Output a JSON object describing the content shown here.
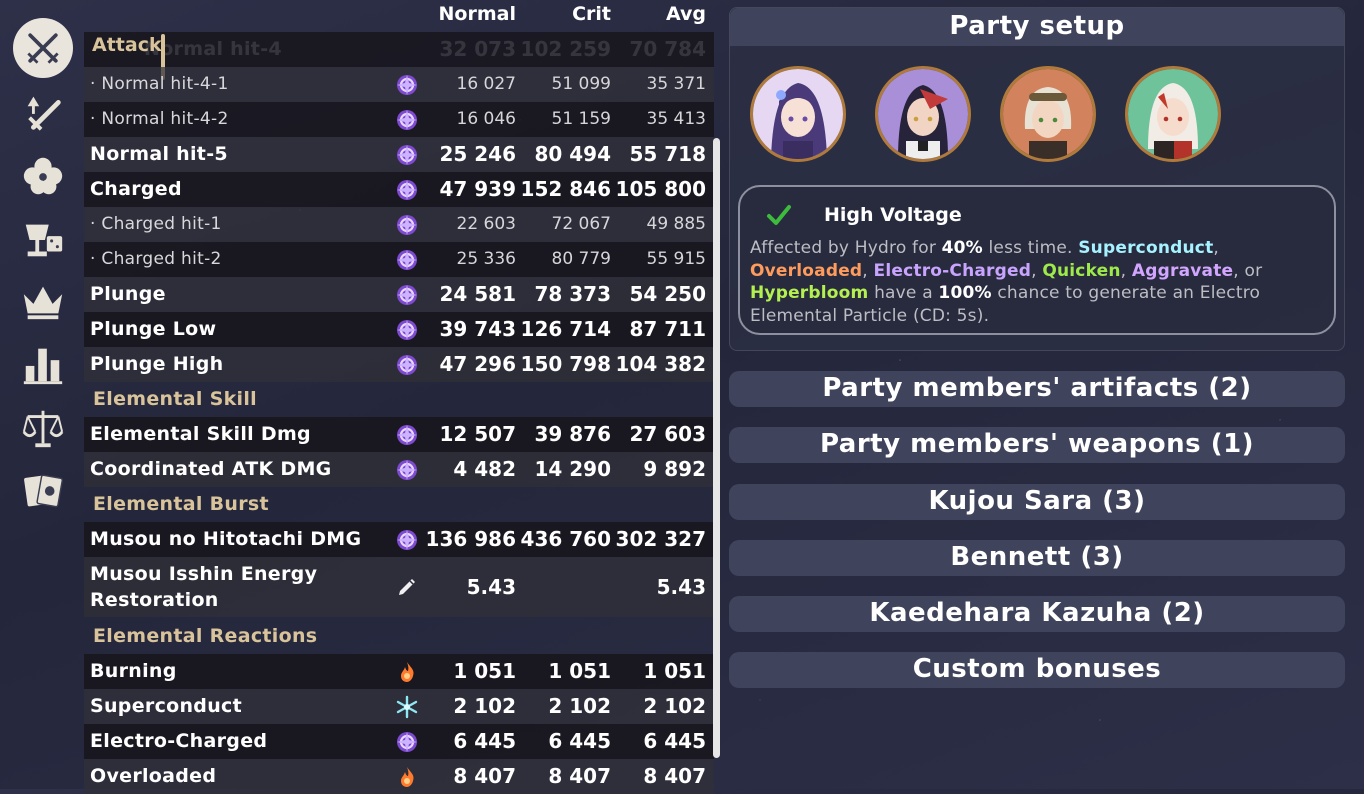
{
  "sidebar": {
    "items": [
      {
        "icon": "crossed-swords-icon"
      },
      {
        "icon": "sword-upgrade-icon"
      },
      {
        "icon": "flower-artifact-icon"
      },
      {
        "icon": "goblet-dice-icon"
      },
      {
        "icon": "crown-icon"
      },
      {
        "icon": "bar-chart-icon"
      },
      {
        "icon": "scales-icon"
      },
      {
        "icon": "cards-icon"
      }
    ]
  },
  "table": {
    "headers": {
      "normal": "Normal",
      "crit": "Crit",
      "avg": "Avg"
    },
    "attack_header": "Attack",
    "hidden_row": {
      "name": "Normal hit-4",
      "normal": "32 073",
      "crit": "102 259",
      "avg": "70 784"
    },
    "rows": [
      {
        "name": "· Normal hit-4-1",
        "icon": "electro-icon",
        "normal": "16 027",
        "crit": "51 099",
        "avg": "35 371"
      },
      {
        "name": "· Normal hit-4-2",
        "icon": "electro-icon",
        "normal": "16 046",
        "crit": "51 159",
        "avg": "35 413"
      },
      {
        "name": "Normal hit-5",
        "icon": "electro-icon",
        "normal": "25 246",
        "crit": "80 494",
        "avg": "55 718"
      },
      {
        "name": "Charged",
        "icon": "electro-icon",
        "normal": "47 939",
        "crit": "152 846",
        "avg": "105 800"
      },
      {
        "name": "· Charged hit-1",
        "icon": "electro-icon",
        "normal": "22 603",
        "crit": "72 067",
        "avg": "49 885"
      },
      {
        "name": "· Charged hit-2",
        "icon": "electro-icon",
        "normal": "25 336",
        "crit": "80 779",
        "avg": "55 915"
      },
      {
        "name": "Plunge",
        "icon": "electro-icon",
        "normal": "24 581",
        "crit": "78 373",
        "avg": "54 250"
      },
      {
        "name": "Plunge Low",
        "icon": "electro-icon",
        "normal": "39 743",
        "crit": "126 714",
        "avg": "87 711"
      },
      {
        "name": "Plunge High",
        "icon": "electro-icon",
        "normal": "47 296",
        "crit": "150 798",
        "avg": "104 382"
      },
      {
        "section": "Elemental Skill"
      },
      {
        "name": "Elemental Skill Dmg",
        "icon": "electro-icon",
        "normal": "12 507",
        "crit": "39 876",
        "avg": "27 603"
      },
      {
        "name": "Coordinated ATK DMG",
        "icon": "electro-icon",
        "normal": "4 482",
        "crit": "14 290",
        "avg": "9 892"
      },
      {
        "section": "Elemental Burst"
      },
      {
        "name": "Musou no Hitotachi DMG",
        "icon": "electro-icon",
        "normal": "136 986",
        "crit": "436 760",
        "avg": "302 327"
      },
      {
        "name": "Musou Isshin Energy Restoration",
        "icon": "energy-pen-icon",
        "normal": "5.43",
        "crit": "",
        "avg": "5.43"
      },
      {
        "section": "Elemental Reactions"
      },
      {
        "name": "Burning",
        "icon": "pyro-icon",
        "normal": "1 051",
        "crit": "1 051",
        "avg": "1 051"
      },
      {
        "name": "Superconduct",
        "icon": "cryo-icon",
        "normal": "2 102",
        "crit": "2 102",
        "avg": "2 102"
      },
      {
        "name": "Electro-Charged",
        "icon": "electro-icon",
        "normal": "6 445",
        "crit": "6 445",
        "avg": "6 445"
      },
      {
        "name": "Overloaded",
        "icon": "pyro-icon",
        "normal": "8 407",
        "crit": "8 407",
        "avg": "8 407"
      }
    ]
  },
  "party": {
    "title": "Party setup",
    "members": [
      {
        "icon": "raiden-portrait-avatar",
        "bg": "#e6d8f2"
      },
      {
        "icon": "sara-portrait-avatar",
        "bg": "#a98fd8"
      },
      {
        "icon": "bennett-portrait-avatar",
        "bg": "#d2825c"
      },
      {
        "icon": "kazuha-portrait-avatar",
        "bg": "#6fc39a"
      }
    ],
    "effect": {
      "title": "High Voltage",
      "desc_1": "Affected by Hydro for ",
      "desc_pct": "40%",
      "desc_2": " less time. ",
      "superconduct": "Superconduct",
      "comma_1": ",",
      "overloaded": "Overloaded",
      "comma_2": ", ",
      "electro_charged": "Electro-Charged",
      "comma_3": ", ",
      "quicken": "Quicken",
      "comma_4": ", ",
      "aggravate": "Aggravate",
      "or": ", or",
      "hyperbloom": "Hyperbloom",
      "desc_3": " have a ",
      "chance": "100%",
      "desc_4": " chance to generate an Electro Elemental Particle (CD: 5s)."
    }
  },
  "accordions": [
    "Party members' artifacts (2)",
    "Party members' weapons (1)",
    "Kujou Sara (3)",
    "Bennett (3)",
    "Kaedehara Kazuha (2)",
    "Custom bonuses"
  ],
  "colors": {
    "accent_gold": "#d8c39a",
    "electro": "#a46cf0",
    "pyro": "#ff7a2c",
    "cryo": "#8ee8f4",
    "check": "#3dbb3d"
  }
}
